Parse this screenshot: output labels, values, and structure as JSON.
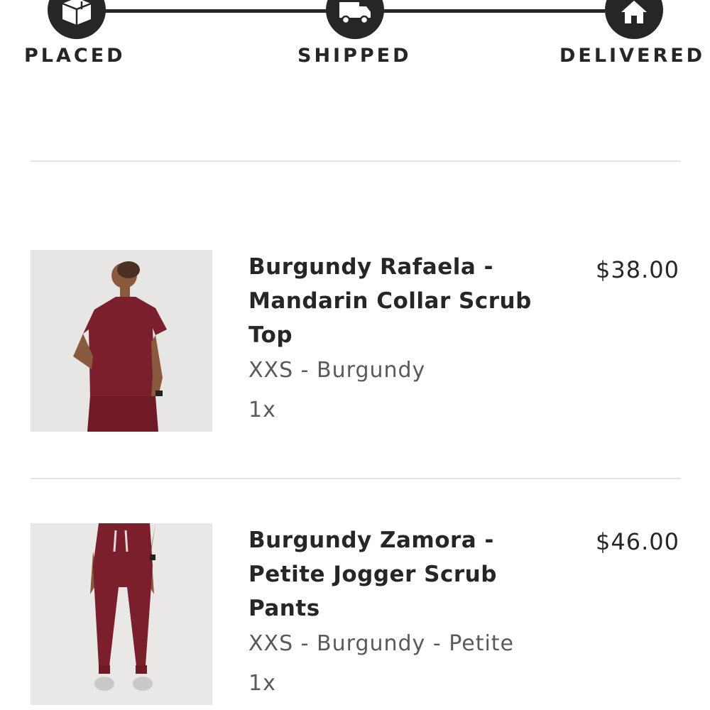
{
  "tracker": {
    "steps": [
      {
        "label": "PLACED",
        "icon": "box-icon"
      },
      {
        "label": "SHIPPED",
        "icon": "truck-icon"
      },
      {
        "label": "DELIVERED",
        "icon": "home-icon"
      }
    ]
  },
  "items": [
    {
      "name": "Burgundy Rafaela - Mandarin Collar Scrub Top",
      "variant": "XXS - Burgundy",
      "quantity": "1x",
      "price": "$38.00",
      "image": "product-photo-scrub-top"
    },
    {
      "name": "Burgundy Zamora - Petite Jogger Scrub Pants",
      "variant": "XXS - Burgundy - Petite",
      "quantity": "1x",
      "price": "$46.00",
      "image": "product-photo-scrub-pants"
    }
  ],
  "colors": {
    "tracker": "#262626",
    "divider": "#e4e4e4",
    "garment": "#7a1f2b"
  }
}
